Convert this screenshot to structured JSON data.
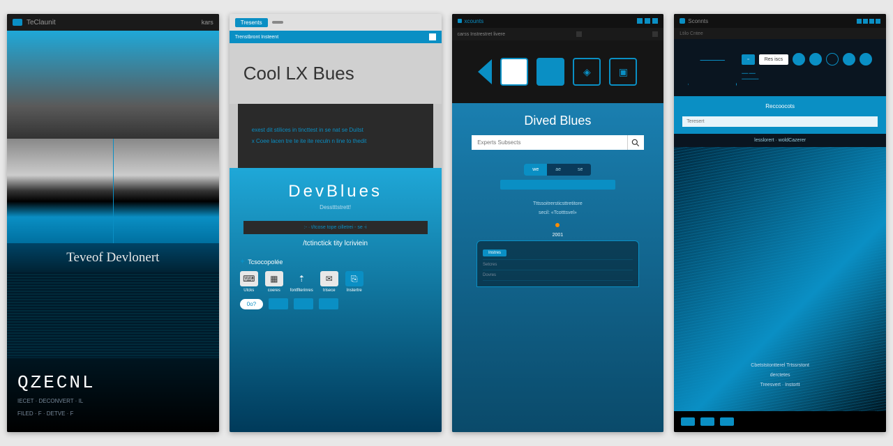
{
  "colors": {
    "accent": "#0a8fc4",
    "dark": "#0a1520",
    "light": "#e8e8e8"
  },
  "panel1": {
    "topLabel": "TeClaunit",
    "topRight": "kars",
    "title": "Teveof Devlonert",
    "logo": "QZECNL",
    "subline1": "IECET · DECONVERT · IL",
    "subline2": "FILED · F · DETVE · F"
  },
  "panel2": {
    "tab1": "Tresents",
    "tab2": "",
    "navText": "Trenstbront Insteent",
    "header": "Cool LX Bues",
    "cardLine1": "exest dit stilices in tincttest in se nat se Duitst",
    "cardLine2": "x Coee lacen tre te ite ite reculn n line to thedit",
    "brand": "DevBlues",
    "brandSub": "Desstttstrett!",
    "barText": ":- · t/tcose tope cilletrei - se -i",
    "link": "/tctinctick tity lcriviein",
    "footLabel": "Tcsocopolée",
    "icons": [
      {
        "glyph": "⌨",
        "label": "Utcks"
      },
      {
        "glyph": "▦",
        "label": "coeres"
      },
      {
        "glyph": "⇡",
        "label": "fontflterinres"
      },
      {
        "glyph": "✉",
        "label": "trisece"
      },
      {
        "glyph": "⎘",
        "label": "Instertre"
      }
    ],
    "pill": "0o?"
  },
  "panel3": {
    "topLabel": "xcounts",
    "subLabel": "carss Instrestret livere",
    "title": "Dived Blues",
    "searchPlaceholder": "Experts Subsects",
    "tabs": [
      "we",
      "ae",
      "se"
    ],
    "smallText1": "Tttssoitrersticsttretitore",
    "smallText2": "secil: «Tcotttsvel»",
    "year": "2001",
    "boxRows": [
      "Instres",
      "Setcres",
      "Dovres"
    ]
  },
  "panel4": {
    "topLabel": "Sconnts",
    "subLabel": "Ltilo Cntee",
    "chipLabel": "Res iscs",
    "bandTitle": "Reccoocots",
    "inputPlaceholder": "Teresert",
    "meta": "lesslorert · woldCazerer",
    "waveText1": "Cbetststontterel Trtssrstont",
    "waveText2": "derctetes",
    "waveText3": "Treesvert · Instortt"
  }
}
